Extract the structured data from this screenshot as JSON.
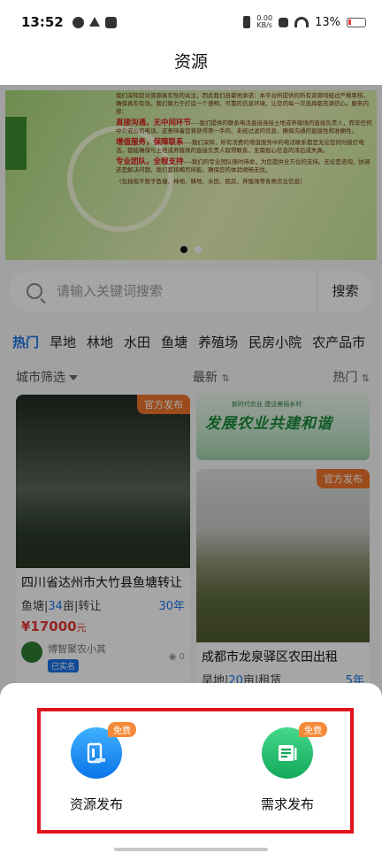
{
  "status_bar": {
    "time": "13:52",
    "net_speed_value": "0.00",
    "net_speed_unit": "KB/s",
    "battery": "13%"
  },
  "title": "资源",
  "banner": {
    "lines": [
      {
        "highlight": "",
        "text": "我们深知您对资源真实性的关注，因此我们自豪地承诺：本平台所提供的所有资源均经过严格审核，确保真实有效。我们致力于打造一个透明、可靠的信息环境，让您的每一次选择都充满信心。服务内容："
      },
      {
        "highlight": "直接沟通，无中间环节",
        "text": "----我们提供的联系电话直接连接土地或养殖场的直接负责人，而非任何中介或公司电话。这意味着您将获得第一手的、未经过滤的信息，确保沟通的直接性和准确性。"
      },
      {
        "highlight": "增值服务，保障联系",
        "text": "----我们深知，所有消费的增值服务中的电话联系都是无论您何时拨打电话，都能确保与土地或养殖场的直接负责人取得联系，无需担心信息的滞后或失真。"
      },
      {
        "highlight": "专业团队，全程支持",
        "text": "----我们的专业团队随时待命，为您提供全方位的支持。无论是咨询、协调还是解决问题，我们都将竭尽所能，确保您的体验顺畅无忧。"
      },
      {
        "highlight": "",
        "text": "（包括但不限于鱼塘、林地、耕地、水田、民房、养殖场等各类农业信息）"
      }
    ]
  },
  "search": {
    "placeholder": "请输入关键词搜索",
    "button": "搜索"
  },
  "tabs": [
    "热门",
    "旱地",
    "林地",
    "水田",
    "鱼塘",
    "养殖场",
    "民房小院",
    "农产品市"
  ],
  "filters": {
    "city": "城市筛选",
    "latest": "最新",
    "hot": "热门",
    "sort_glyph": "⇅"
  },
  "listings": [
    {
      "tag": "官方发布",
      "title": "四川省达州市大竹县鱼塘转让",
      "type": "鱼塘",
      "area_value": "34",
      "area_unit": "亩",
      "deal": "转让",
      "years": "30年",
      "price": "¥17000",
      "price_unit": "元",
      "publisher": "博智聚农小其",
      "verified": "已实名",
      "views": "0"
    },
    {
      "tag": "官方发布",
      "title": "成都市龙泉驿区农田出租",
      "type": "旱地",
      "area_value": "20",
      "area_unit": "亩",
      "deal": "租赁",
      "years": "5年"
    }
  ],
  "ad": {
    "title": "发展农业共建和谐",
    "subtitle": "新时代农业 建设美丽乡村"
  },
  "sheet": {
    "publish_label": "资源发布",
    "demand_label": "需求发布",
    "free_badge": "免费"
  },
  "colors": {
    "accent_blue": "#1a73e8",
    "price_red": "#e53935",
    "tag_orange": "#f0762c",
    "highlight_frame": "#e0141e",
    "publish_icon": "#1f8ef1",
    "demand_icon": "#22c070"
  }
}
